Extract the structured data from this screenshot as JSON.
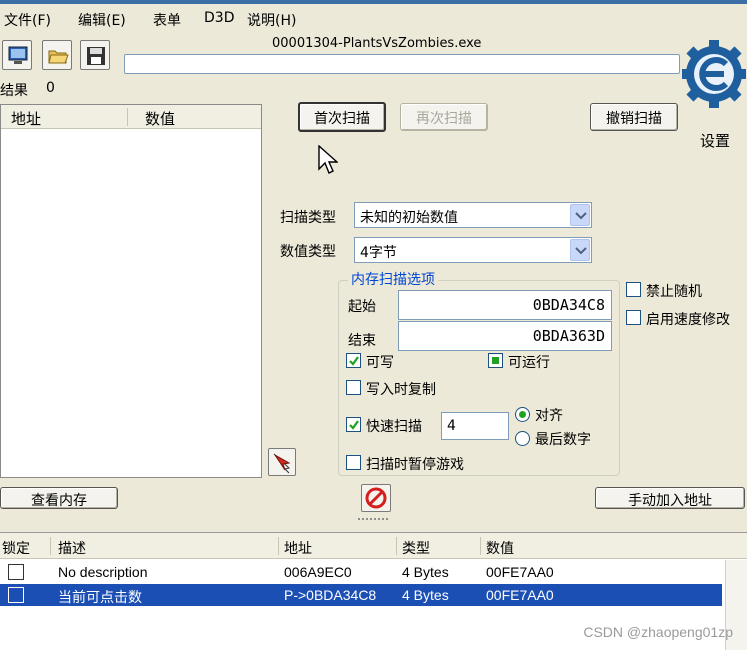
{
  "menu": [
    "文件(F)",
    "编辑(E)",
    "表单",
    "D3D",
    "说明(H)"
  ],
  "toolbar": {
    "process_title": "00001304-PlantsVsZombies.exe"
  },
  "found": {
    "label": "结果",
    "count": "0"
  },
  "scan_list": {
    "columns": [
      "地址",
      "数值"
    ]
  },
  "buttons": {
    "first_scan": "首次扫描",
    "next_scan": "再次扫描",
    "undo_scan": "撤销扫描",
    "settings": "设置",
    "memory_view": "查看内存",
    "add_address_manually": "手动加入地址"
  },
  "scan": {
    "scan_type_label": "扫描类型",
    "scan_type_value": "未知的初始数值",
    "value_type_label": "数值类型",
    "value_type_value": "4字节"
  },
  "memory_options": {
    "title": "内存扫描选项",
    "start_label": "起始",
    "start_value": "0BDA34C8",
    "stop_label": "结束",
    "stop_value": "0BDA363D",
    "writable": "可写",
    "executable": "可运行",
    "copy_on_write": "写入时复制",
    "fast_scan": "快速扫描",
    "fast_scan_value": "4",
    "alignment": "对齐",
    "last_digits": "最后数字",
    "pause_game": "扫描时暂停游戏"
  },
  "right_options": {
    "disable_random": "禁止随机",
    "speedhack": "启用速度修改"
  },
  "address_table": {
    "columns": [
      "锁定",
      "描述",
      "地址",
      "类型",
      "数值"
    ],
    "rows": [
      {
        "description": "No description",
        "address": "006A9EC0",
        "type": "4 Bytes",
        "value": "00FE7AA0",
        "selected": false
      },
      {
        "description": "当前可点击数",
        "address": "P->0BDA34C8",
        "type": "4 Bytes",
        "value": "00FE7AA0",
        "selected": true
      }
    ]
  },
  "watermark": "CSDN @zhaopeng01zp",
  "icons": {
    "open_process": "computer-icon",
    "open_file": "folder-open-icon",
    "save": "floppy-disk-icon",
    "logo": "cheat-engine-logo",
    "pointer": "arrow-pointer-icon",
    "stop": "stop-sign-icon"
  }
}
